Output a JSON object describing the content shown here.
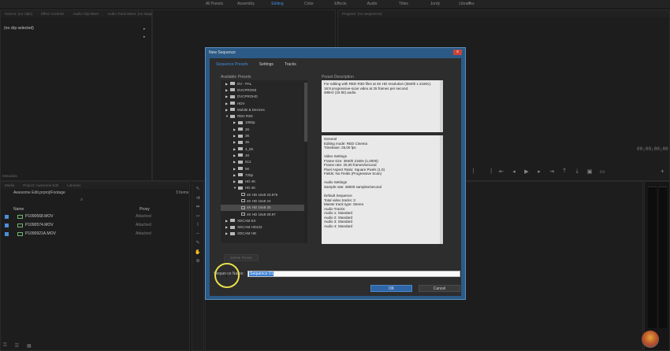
{
  "workspaces": [
    "All Panels",
    "Assembly",
    "Editing",
    "Color",
    "Effects",
    "Audio",
    "Titles",
    "Jordy",
    "Libraries"
  ],
  "workspace_active": "Editing",
  "workspace_more": "»",
  "source_panel": {
    "tabs": [
      "Source: (no clips)",
      "Effect Controls",
      "Audio Clip Mixer",
      "Audio Track Mixer: (no sequences)"
    ],
    "no_clip": "(no clip selected)",
    "metadata_tab": "Metadata"
  },
  "program_panel": {
    "tab": "Program: (no sequences)",
    "timecode": "00;00;00;00"
  },
  "project_panel": {
    "tabs": [
      "Media",
      "Project: Awesome Edit",
      "Libraries"
    ],
    "path": "Awesome Edit.prproj\\Footage",
    "items_count": "3 Items",
    "columns": {
      "name": "Name",
      "proxy": "Proxy"
    },
    "files": [
      {
        "name": "P1090568.MOV",
        "proxy": "Attached"
      },
      {
        "name": "P1090574.MOV",
        "proxy": "Attached"
      },
      {
        "name": "P1090921A.MOV",
        "proxy": "Attached"
      }
    ]
  },
  "dialog": {
    "title": "New Sequence",
    "close": "x",
    "tabs": [
      "Sequence Presets",
      "Settings",
      "Tracks"
    ],
    "available_presets_label": "Available Presets",
    "preset_description_label": "Preset Description",
    "tree": [
      {
        "label": "DV - PAL",
        "indent": 0,
        "type": "folder"
      },
      {
        "label": "DVCPRO50",
        "indent": 0,
        "type": "folder"
      },
      {
        "label": "DVCPROHD",
        "indent": 0,
        "type": "folder"
      },
      {
        "label": "HDV",
        "indent": 0,
        "type": "folder"
      },
      {
        "label": "Mobile & Devices",
        "indent": 0,
        "type": "folder"
      },
      {
        "label": "RED R3D",
        "indent": 0,
        "type": "folder",
        "open": true
      },
      {
        "label": "1080p",
        "indent": 1,
        "type": "folder"
      },
      {
        "label": "2K",
        "indent": 1,
        "type": "folder"
      },
      {
        "label": "3K",
        "indent": 1,
        "type": "folder"
      },
      {
        "label": "3K",
        "indent": 1,
        "type": "folder"
      },
      {
        "label": "4_5K",
        "indent": 1,
        "type": "folder"
      },
      {
        "label": "4K",
        "indent": 1,
        "type": "folder"
      },
      {
        "label": "512",
        "indent": 1,
        "type": "folder"
      },
      {
        "label": "5K",
        "indent": 1,
        "type": "folder"
      },
      {
        "label": "720p",
        "indent": 1,
        "type": "folder"
      },
      {
        "label": "HD 4K",
        "indent": 1,
        "type": "folder"
      },
      {
        "label": "HD 4K",
        "indent": 1,
        "type": "folder",
        "open": true
      },
      {
        "label": "4K HD 16x9 23.976",
        "indent": 2,
        "type": "seq"
      },
      {
        "label": "4K HD 16x9 24",
        "indent": 2,
        "type": "seq"
      },
      {
        "label": "4K HD 16x9 25",
        "indent": 2,
        "type": "seq",
        "selected": true
      },
      {
        "label": "4K HD 16x9 29.97",
        "indent": 2,
        "type": "seq"
      },
      {
        "label": "XDCAM EX",
        "indent": 0,
        "type": "folder"
      },
      {
        "label": "XDCAM HD422",
        "indent": 0,
        "type": "folder"
      },
      {
        "label": "XDCAM HD",
        "indent": 0,
        "type": "folder"
      }
    ],
    "description": [
      "For editing with RED R3D files at 4K HD resolution (3840h x 2160v).",
      "16:9 progressive-scan video at 25 frames per second.",
      "48kHz (16 bit) audio."
    ],
    "info": [
      "General",
      "Editing mode: RED Cinema",
      "Timebase: 25,00 fps",
      "",
      "Video Settings",
      "Frame size: 3840h 2160v (1,0000)",
      "Frame rate: 25,00  frames/second",
      "Pixel Aspect Ratio: Square Pixels (1.0)",
      "Fields: No Fields (Progressive Scan)",
      "",
      "Audio Settings",
      "Sample rate: 48000 samples/second",
      "",
      "Default Sequence",
      "Total video tracks: 3",
      "Master track type: Stereo",
      "Audio Tracks:",
      "Audio 1: Standard",
      "Audio 2: Standard",
      "Audio 3: Standard",
      "Audio 4: Standard"
    ],
    "delete_preset": "Delete Preset",
    "sequence_name_label": "Sequence Name:",
    "sequence_name_value": "Sequence 01",
    "ok": "OK",
    "cancel": "Cancel"
  }
}
